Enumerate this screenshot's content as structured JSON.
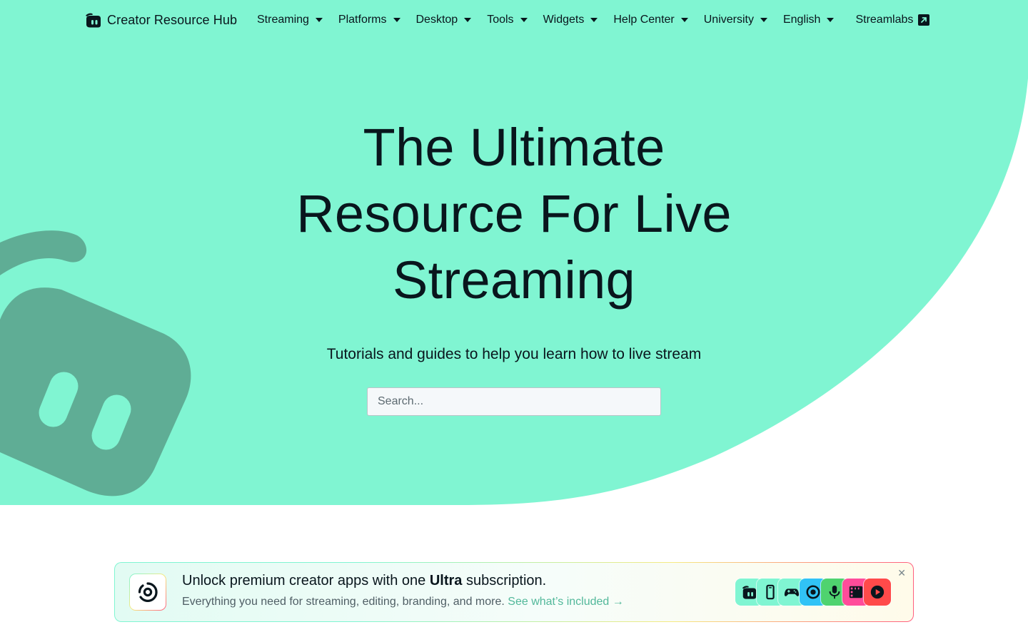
{
  "colors": {
    "hero_background": "#80f5d2",
    "mascot": "#5fad95",
    "text": "#09161d",
    "link": "#52b89a"
  },
  "nav": {
    "brand": {
      "icon": "streamlabs-logo-icon",
      "label": "Creator Resource Hub"
    },
    "items": [
      {
        "label": "Streaming",
        "icon": "caret-down-icon"
      },
      {
        "label": "Platforms",
        "icon": "caret-down-icon"
      },
      {
        "label": "Desktop",
        "icon": "caret-down-icon"
      },
      {
        "label": "Tools",
        "icon": "caret-down-icon"
      },
      {
        "label": "Widgets",
        "icon": "caret-down-icon"
      },
      {
        "label": "Help Center",
        "icon": "caret-down-icon"
      },
      {
        "label": "University",
        "icon": "caret-down-icon"
      },
      {
        "label": "English",
        "icon": "caret-down-icon"
      }
    ],
    "external": {
      "label": "Streamlabs",
      "icon": "external-link-icon"
    }
  },
  "hero": {
    "title": "The Ultimate Resource For Live Streaming",
    "subtitle": "Tutorials and guides to help you learn how to live stream",
    "search_placeholder": "Search..."
  },
  "promo": {
    "logo_icon": "ultra-logo-icon",
    "title_pre": "Unlock premium creator apps with one ",
    "title_bold": "Ultra",
    "title_post": " subscription.",
    "description": "Everything you need for streaming, editing, branding, and more.",
    "link_label": "See what’s included →",
    "close_label": "✕",
    "apps": [
      {
        "icon": "streamlabs-app-icon",
        "color": "#80f5d2"
      },
      {
        "icon": "mobile-app-icon",
        "color": "#80f5d2"
      },
      {
        "icon": "console-app-icon",
        "color": "#80f5d2"
      },
      {
        "icon": "record-app-icon",
        "color": "#31c3f6"
      },
      {
        "icon": "podcast-mic-app-icon",
        "color": "#4fd36f"
      },
      {
        "icon": "video-editor-app-icon",
        "color": "#ff4c9a"
      },
      {
        "icon": "player-app-icon",
        "color": "#ff4a4a"
      }
    ]
  }
}
